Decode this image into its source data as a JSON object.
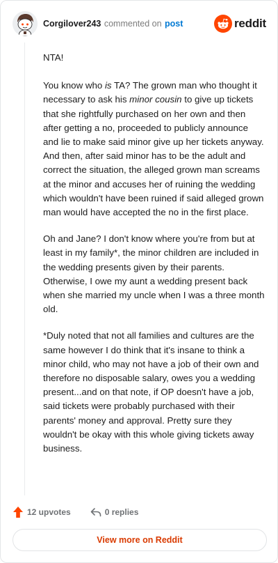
{
  "header": {
    "username": "Corgilover243",
    "commented_text": "commented on",
    "post_link": "post",
    "brand": "reddit"
  },
  "comment": {
    "p1": "NTA!",
    "p2_a": "You know who ",
    "p2_em1": "is",
    "p2_b": " TA? The grown man who thought it necessary to ask his ",
    "p2_em2": "minor cousin",
    "p2_c": " to give up tickets that she rightfully purchased on her own and then after getting a no, proceeded to publicly announce and lie to make said minor give up her tickets anyway. And then, after said minor has to be the adult and correct the situation, the alleged grown man screams at the minor and accuses her of ruining the wedding which wouldn't have been ruined if said alleged grown man would have accepted the no in the first place.",
    "p3": "Oh and Jane? I don't know where you're from but at least in my family*, the minor children are included in the wedding presents given by their parents. Otherwise, I owe my aunt a wedding present back when she married my uncle when I was a three month old.",
    "p4": "*Duly noted that not all families and cultures are the same however I do think that it's insane to think a minor child, who may not have a job of their own and therefore no disposable salary, owes you a wedding present...and on that note, if OP doesn't have a job, said tickets were probably purchased with their parents' money and approval. Pretty sure they wouldn't be okay with this whole giving tickets away business."
  },
  "actions": {
    "upvotes": "12 upvotes",
    "replies": "0 replies"
  },
  "footer": {
    "view_more": "View more on Reddit"
  },
  "colors": {
    "brand_orange": "#ff4500",
    "link_blue": "#0079d3",
    "view_more_text": "#d93a00"
  },
  "icons": {
    "avatar": "snoo-avatar",
    "brand": "reddit-logo-icon",
    "upvote": "upvote-arrow-icon",
    "reply": "reply-arrow-icon"
  }
}
